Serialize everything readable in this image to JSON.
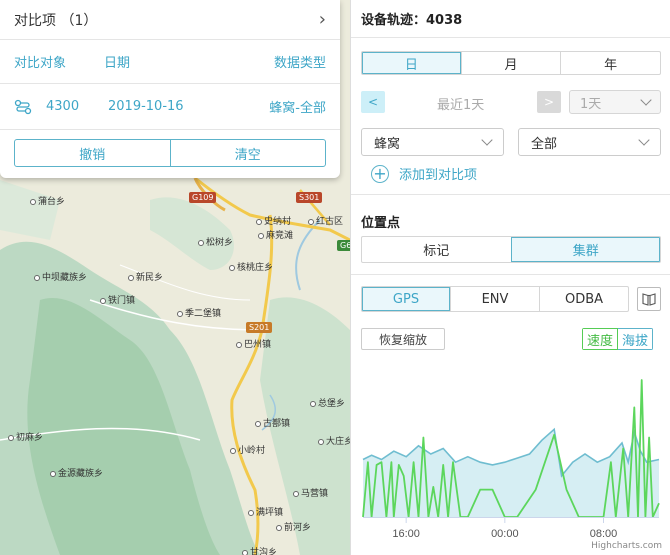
{
  "compare": {
    "title": "对比项 （1）",
    "columns": [
      "对比对象",
      "日期",
      "数据类型"
    ],
    "row": {
      "device": "4300",
      "date": "2019-10-16",
      "type": "蜂窝-全部"
    },
    "cancel_label": "撤销",
    "clear_label": "清空"
  },
  "map": {
    "places": [
      "蒲台乡",
      "史纳村",
      "红古区",
      "麻竞滩",
      "松树乡",
      "核桃庄乡",
      "中坝藏族乡",
      "新民乡",
      "铁门镇",
      "季二堡镇",
      "巴州镇",
      "总堡乡",
      "初麻乡",
      "古鄯镇",
      "大庄乡",
      "小岭村",
      "金源藏族乡",
      "马营镇",
      "满坪镇",
      "前河乡",
      "甘沟乡"
    ],
    "roads": [
      "G109",
      "S301",
      "G6",
      "S201"
    ]
  },
  "panel": {
    "title": "设备轨迹：4038",
    "period_tabs": [
      "日",
      "月",
      "年"
    ],
    "prev_label": "<",
    "next_label": ">",
    "range_label": "最近1天",
    "range_select": "1天",
    "network_select": "蜂窝",
    "type_select": "全部",
    "add_label": "添加到对比项",
    "position_title": "位置点",
    "position_tabs": [
      "标记",
      "集群"
    ],
    "data_tabs": [
      "GPS",
      "ENV",
      "ODBA"
    ],
    "reset_label": "恢复缩放",
    "speed_label": "速度",
    "altitude_label": "海拔",
    "credits": "Highcharts.com"
  },
  "colors": {
    "accent": "#3ea6c7",
    "speed": "#5cd65c",
    "altitude": "#6fbdd0",
    "altitude_fill": "#d6eef3"
  },
  "chart_data": {
    "type": "line",
    "x_tick_labels": [
      "16:00",
      "00:00",
      "08:00"
    ],
    "x_tick_hours": [
      16,
      24,
      32
    ],
    "x_range_hours": [
      12.5,
      36.5
    ],
    "series": [
      {
        "name": "海拔",
        "type": "area",
        "points": [
          [
            12.5,
            0.42
          ],
          [
            13.2,
            0.45
          ],
          [
            14.0,
            0.42
          ],
          [
            15.0,
            0.48
          ],
          [
            16.0,
            0.44
          ],
          [
            17.0,
            0.52
          ],
          [
            18.0,
            0.46
          ],
          [
            19.0,
            0.5
          ],
          [
            20.0,
            0.4
          ],
          [
            21.0,
            0.44
          ],
          [
            22.0,
            0.4
          ],
          [
            23.0,
            0.38
          ],
          [
            24.0,
            0.4
          ],
          [
            25.0,
            0.43
          ],
          [
            26.0,
            0.46
          ],
          [
            27.0,
            0.56
          ],
          [
            28.0,
            0.64
          ],
          [
            28.6,
            0.3
          ],
          [
            29.5,
            0.4
          ],
          [
            30.5,
            0.46
          ],
          [
            31.5,
            0.4
          ],
          [
            32.5,
            0.44
          ],
          [
            33.5,
            0.54
          ],
          [
            34.0,
            0.4
          ],
          [
            34.5,
            0.62
          ],
          [
            35.0,
            0.48
          ],
          [
            35.5,
            0.4
          ],
          [
            36.5,
            0.42
          ]
        ]
      },
      {
        "name": "速度",
        "type": "line",
        "points": [
          [
            12.5,
            0.0
          ],
          [
            12.9,
            0.4
          ],
          [
            13.2,
            0.0
          ],
          [
            13.6,
            0.38
          ],
          [
            14.0,
            0.4
          ],
          [
            14.4,
            0.0
          ],
          [
            14.8,
            0.4
          ],
          [
            15.0,
            0.0
          ],
          [
            15.4,
            0.38
          ],
          [
            15.8,
            0.3
          ],
          [
            16.2,
            0.0
          ],
          [
            16.6,
            0.4
          ],
          [
            17.0,
            0.0
          ],
          [
            17.4,
            0.58
          ],
          [
            17.8,
            0.0
          ],
          [
            18.2,
            0.22
          ],
          [
            18.6,
            0.0
          ],
          [
            19.0,
            0.38
          ],
          [
            19.4,
            0.0
          ],
          [
            19.8,
            0.4
          ],
          [
            20.4,
            0.0
          ],
          [
            21.0,
            0.0
          ],
          [
            22.0,
            0.2
          ],
          [
            23.0,
            0.2
          ],
          [
            24.0,
            0.0
          ],
          [
            25.0,
            0.0
          ],
          [
            26.5,
            0.2
          ],
          [
            28.0,
            0.6
          ],
          [
            29.0,
            0.2
          ],
          [
            30.0,
            0.0
          ],
          [
            31.0,
            0.0
          ],
          [
            32.0,
            0.0
          ],
          [
            32.6,
            0.4
          ],
          [
            33.0,
            0.0
          ],
          [
            33.6,
            0.5
          ],
          [
            34.0,
            0.0
          ],
          [
            34.5,
            0.8
          ],
          [
            34.8,
            0.0
          ],
          [
            35.1,
            1.0
          ],
          [
            35.4,
            0.0
          ],
          [
            35.7,
            0.58
          ],
          [
            36.0,
            0.0
          ],
          [
            36.5,
            0.1
          ]
        ]
      }
    ]
  }
}
